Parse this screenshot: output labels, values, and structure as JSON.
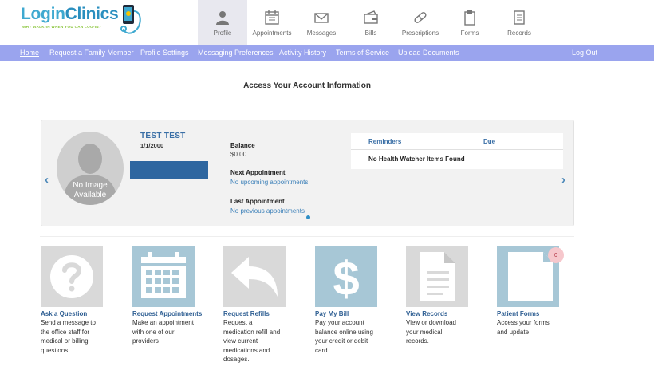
{
  "brand": {
    "name_part1": "Login",
    "name_part2": "Clinics",
    "tagline": "WHY WALK-IN WHEN YOU CAN LOG-IN?"
  },
  "top_nav": [
    {
      "label": "Profile",
      "icon": "profile-icon",
      "active": true
    },
    {
      "label": "Appointments",
      "icon": "calendar-icon",
      "active": false
    },
    {
      "label": "Messages",
      "icon": "envelope-icon",
      "active": false
    },
    {
      "label": "Bills",
      "icon": "wallet-icon",
      "active": false
    },
    {
      "label": "Prescriptions",
      "icon": "pill-icon",
      "active": false
    },
    {
      "label": "Forms",
      "icon": "clipboard-icon",
      "active": false
    },
    {
      "label": "Records",
      "icon": "document-icon",
      "active": false
    }
  ],
  "sub_nav": {
    "items": [
      {
        "label": "Home",
        "active": true
      },
      {
        "label": "Request a Family Member"
      },
      {
        "label": "Profile Settings"
      },
      {
        "label": "Messaging Preferences"
      },
      {
        "label": "Activity History"
      },
      {
        "label": "Terms of Service"
      },
      {
        "label": "Upload Documents"
      }
    ],
    "logout": "Log Out"
  },
  "page_title": "Access Your Account Information",
  "account": {
    "avatar_caption": "No Image Available",
    "patient_name": "TEST TEST",
    "dob": "1/1/2000",
    "balance_label": "Balance",
    "balance_value": "$0.00",
    "next_appt_label": "Next Appointment",
    "next_appt_value": "No upcoming appointments",
    "last_appt_label": "Last Appointment",
    "last_appt_value": "No previous appointments",
    "reminders": {
      "col_reminders": "Reminders",
      "col_due": "Due",
      "empty": "No Health Watcher Items Found"
    },
    "prev_arrow": "‹",
    "next_arrow": "›"
  },
  "tiles": [
    {
      "title": "Ask a Question",
      "desc": "Send a message to the office staff for medical or billing questions.",
      "icon": "question-icon",
      "color": "#d9d9d9"
    },
    {
      "title": "Request Appointments",
      "desc": "Make an appointment with one of our providers",
      "icon": "calendar-icon",
      "color": "#a7c7d6"
    },
    {
      "title": "Request Refills",
      "desc": "Request a medication refill and view current medications and dosages.",
      "icon": "reply-arrow-icon",
      "color": "#d9d9d9"
    },
    {
      "title": "Pay My Bill",
      "desc": "Pay your account balance online using your credit or debit card.",
      "icon": "dollar-icon",
      "color": "#a7c7d6"
    },
    {
      "title": "View Records",
      "desc": "View or download your medical records.",
      "icon": "document-icon",
      "color": "#d9d9d9"
    },
    {
      "title": "Patient Forms",
      "desc": "Access your forms and update",
      "icon": "form-page-icon",
      "color": "#a7c7d6",
      "badge": "0"
    }
  ],
  "colors": {
    "subnav_bg": "#9aa4ee",
    "link_blue": "#3a7fb8",
    "tile_gray": "#d9d9d9",
    "tile_blue": "#a7c7d6",
    "redaction": "#2e66a0"
  }
}
